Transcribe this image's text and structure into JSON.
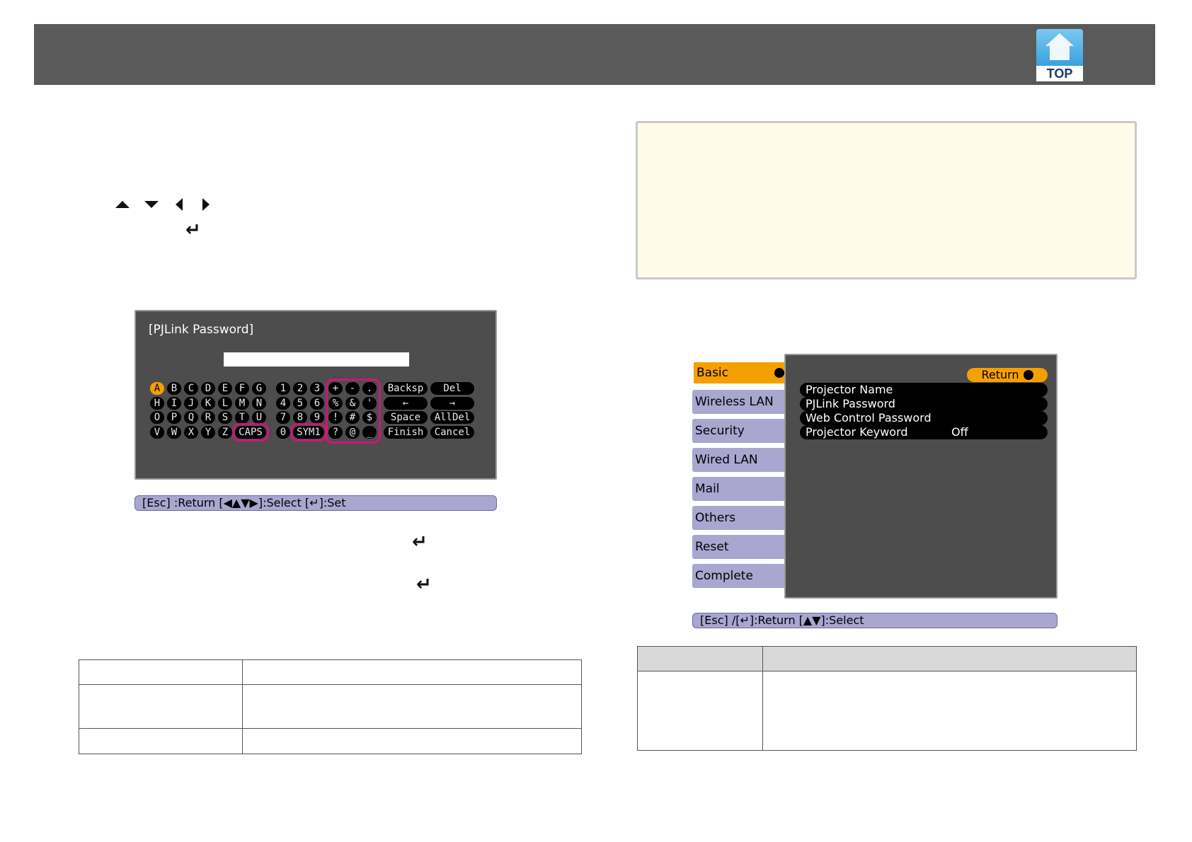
{
  "header": {
    "logo_text": "TOP"
  },
  "keyboard_dialog": {
    "title": "[PJLink Password]",
    "keys": [
      [
        "A",
        "B",
        "C",
        "D",
        "E",
        "F",
        "G",
        "1",
        "2",
        "3",
        "+",
        "-",
        "."
      ],
      [
        "H",
        "I",
        "J",
        "K",
        "L",
        "M",
        "N",
        "4",
        "5",
        "6",
        "%",
        "&",
        "'"
      ],
      [
        "O",
        "P",
        "Q",
        "R",
        "S",
        "T",
        "U",
        "7",
        "8",
        "9",
        "!",
        "#",
        "$"
      ],
      [
        "V",
        "W",
        "X",
        "Y",
        "Z",
        "CAPS",
        "0",
        "SYM1",
        "?",
        "@",
        "_"
      ]
    ],
    "func_keys": [
      [
        "Backsp",
        "Del"
      ],
      [
        "←",
        "→"
      ],
      [
        "Space",
        "AllDel"
      ],
      [
        "Finish",
        "Cancel"
      ]
    ],
    "help_bar": "[Esc] :Return  [◀▲▼▶]:Select  [↵]:Set"
  },
  "network_menu": {
    "tabs": [
      "Basic",
      "Wireless LAN",
      "Security",
      "Wired LAN",
      "Mail",
      "Others",
      "Reset",
      "Complete"
    ],
    "active_tab": "Basic",
    "return_label": "Return",
    "rows": [
      {
        "label": "Projector Name",
        "value": ""
      },
      {
        "label": "PJLink Password",
        "value": ""
      },
      {
        "label": "Web Control Password",
        "value": ""
      },
      {
        "label": "Projector Keyword",
        "value": "Off"
      }
    ],
    "help_bar": "[Esc] /[↵]:Return  [▲▼]:Select"
  },
  "colors": {
    "header": "#5a5a5a",
    "menu_bg": "#4d4d4d",
    "tab": "#a9a6d0",
    "accent": "#f5a000",
    "highlight": "#d0157a",
    "note_bg": "#fffbea"
  }
}
